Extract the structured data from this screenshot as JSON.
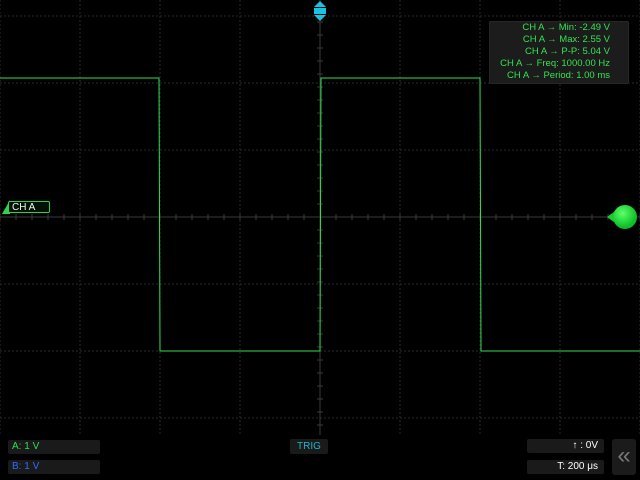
{
  "measurements": {
    "min": "CH A → Min: -2.49 V",
    "max": "CH A → Max: 2.55 V",
    "pp": "CH A → P-P: 5.04 V",
    "freq": "CH A → Freq: 1000.00 Hz",
    "period": "CH A → Period: 1.00 ms"
  },
  "channel_label": "CH A",
  "bottom_bar": {
    "channel_a_scale": "A: 1 V",
    "channel_b_scale": "B: 1 V",
    "trigger_button": "TRIG",
    "trigger_level": "↑ : 0V",
    "time_base": "T: 200 μs"
  },
  "colors": {
    "trace": "#2fe050",
    "grid": "#2a2a2a",
    "channel_b": "#2f6bff",
    "trigger": "#20b5cc"
  },
  "icons": {
    "collapse": "chevron-double-left-icon",
    "trigger_marker": "trigger-position-icon",
    "trigger_level": "trigger-level-icon"
  }
}
